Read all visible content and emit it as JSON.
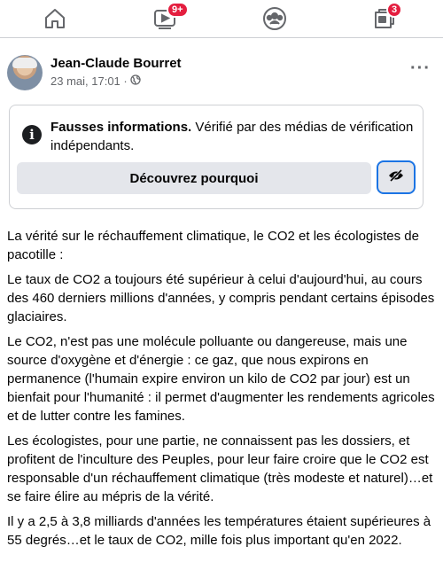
{
  "nav": {
    "items": [
      {
        "icon": "home-icon"
      },
      {
        "icon": "video-icon",
        "badge": "9+"
      },
      {
        "icon": "groups-icon"
      },
      {
        "icon": "pages-icon",
        "badge": "3"
      }
    ],
    "badge_color": "#e41e3f"
  },
  "post": {
    "author": "Jean-Claude Bourret",
    "timestamp": "23 mai, 17:01 ·",
    "more": "···"
  },
  "warning": {
    "title": "Fausses informations.",
    "message": " Vérifié par des médias de vérification indépendants.",
    "learn_button": "Découvrez pourquoi",
    "accent": "#1b74e4"
  },
  "body": {
    "paragraphs": [
      "La vérité sur le réchauffement climatique, le CO2 et les écologistes de pacotille :",
      "Le taux de CO2  a toujours été supérieur  à celui d'aujourd'hui, au cours des 460 derniers millions d'années, y compris pendant certains épisodes glaciaires.",
      "Le CO2, n'est pas une molécule polluante ou dangereuse, mais une source d'oxygène et d'énergie : ce gaz, que nous expirons en permanence (l'humain expire environ un kilo de CO2 par jour) est un bienfait pour l'humanité : il permet d'augmenter les rendements agricoles et de lutter contre les famines.",
      "Les écologistes, pour une partie, ne connaissent pas les dossiers, et profitent de l'inculture des Peuples, pour leur faire croire que le CO2 est responsable d'un réchauffement climatique (très modeste et naturel)…et se faire élire au mépris de la vérité.",
      "Il y a  2,5 à 3,8 milliards d'années les températures étaient  supérieures à 55 degrés…et le taux de CO2, mille fois plus important qu'en 2022."
    ]
  }
}
